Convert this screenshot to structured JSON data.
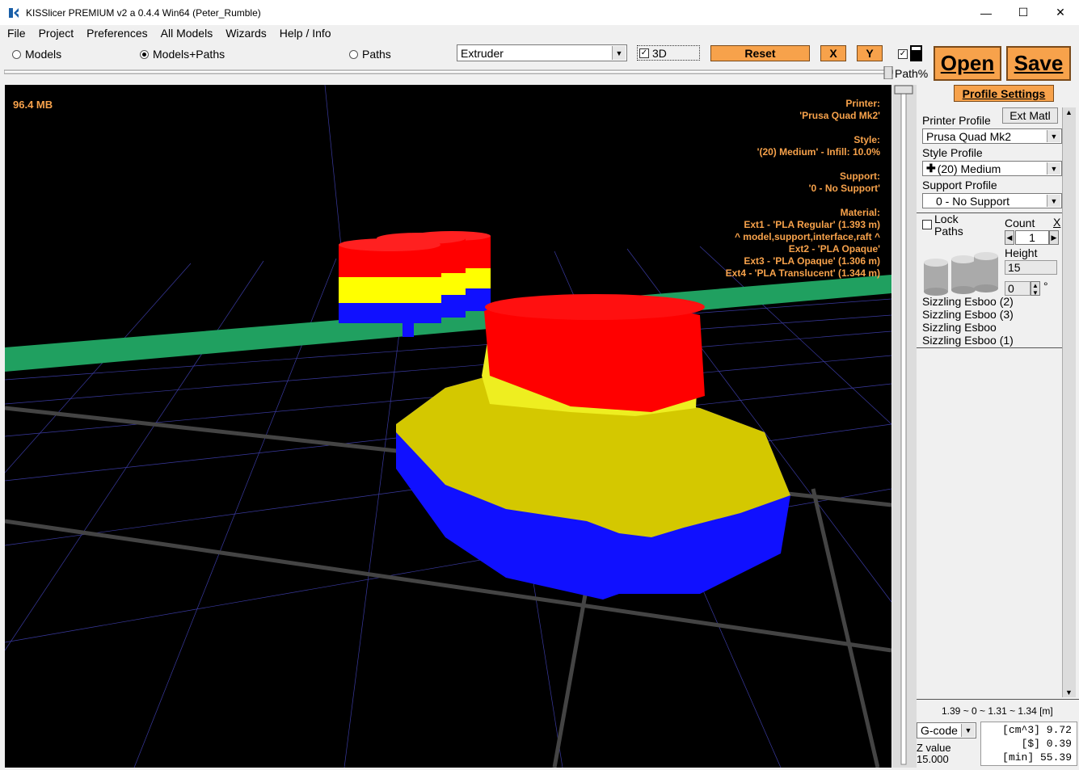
{
  "window": {
    "title": "KISSlicer PREMIUM v2 a 0.4.4 Win64 (Peter_Rumble)"
  },
  "menu": [
    "File",
    "Project",
    "Preferences",
    "All Models",
    "Wizards",
    "Help / Info"
  ],
  "view_modes": {
    "models": "Models",
    "models_paths": "Models+Paths",
    "paths": "Paths",
    "selected": "Models+Paths"
  },
  "toolbar": {
    "extruder_select": "Extruder",
    "three_d_label": "3D",
    "reset_label": "Reset",
    "x_label": "X",
    "y_label": "Y",
    "path_pct_label": "Path%",
    "open_label": "Open",
    "save_label": "Save"
  },
  "viewport": {
    "memory": "96.4 MB",
    "info_lines": [
      "Printer:",
      "'Prusa Quad Mk2'",
      "",
      "Style:",
      "'(20) Medium' - Infill: 10.0%",
      "",
      "Support:",
      "'0 - No Support'",
      "",
      "Material:",
      "Ext1 - 'PLA Regular' (1.393 m)",
      "^ model,support,interface,raft ^",
      "Ext2 - 'PLA Opaque'",
      "Ext3 - 'PLA Opaque' (1.306 m)",
      "Ext4 - 'PLA Translucent' (1.344 m)"
    ]
  },
  "panel": {
    "profile_settings_label": "Profile Settings",
    "ext_matl_label": "Ext Matl",
    "printer_profile_label": "Printer Profile",
    "printer_profile_value": "Prusa Quad Mk2",
    "style_profile_label": "Style Profile",
    "style_profile_value": "(20) Medium",
    "support_profile_label": "Support Profile",
    "support_profile_value": "0 - No Support",
    "lock_label": "Lock",
    "paths_label": "Paths",
    "count_label": "Count",
    "count_value": "1",
    "close_x": "X",
    "height_label": "Height",
    "height_value": "15",
    "rotation_value": "0",
    "degree_symbol": "°",
    "models": [
      "Sizzling Esboo (2)",
      "Sizzling Esboo (3)",
      "Sizzling Esboo",
      "Sizzling Esboo (1)"
    ],
    "extrusion_summary": "1.39 ~ 0 ~ 1.31 ~ 1.34 [m]",
    "output_select": "G-code",
    "z_value_label": "Z value",
    "z_value": "15.000",
    "stats": [
      {
        "unit": "[cm^3]",
        "value": "9.72"
      },
      {
        "unit": "[$]",
        "value": "0.39"
      },
      {
        "unit": "[min]",
        "value": "55.39"
      }
    ]
  },
  "colors": {
    "accent": "#f7a24b",
    "red": "#ff0000",
    "yellow": "#ffff00",
    "blue": "#0000ff",
    "green": "#20a060",
    "background": "#000000"
  }
}
